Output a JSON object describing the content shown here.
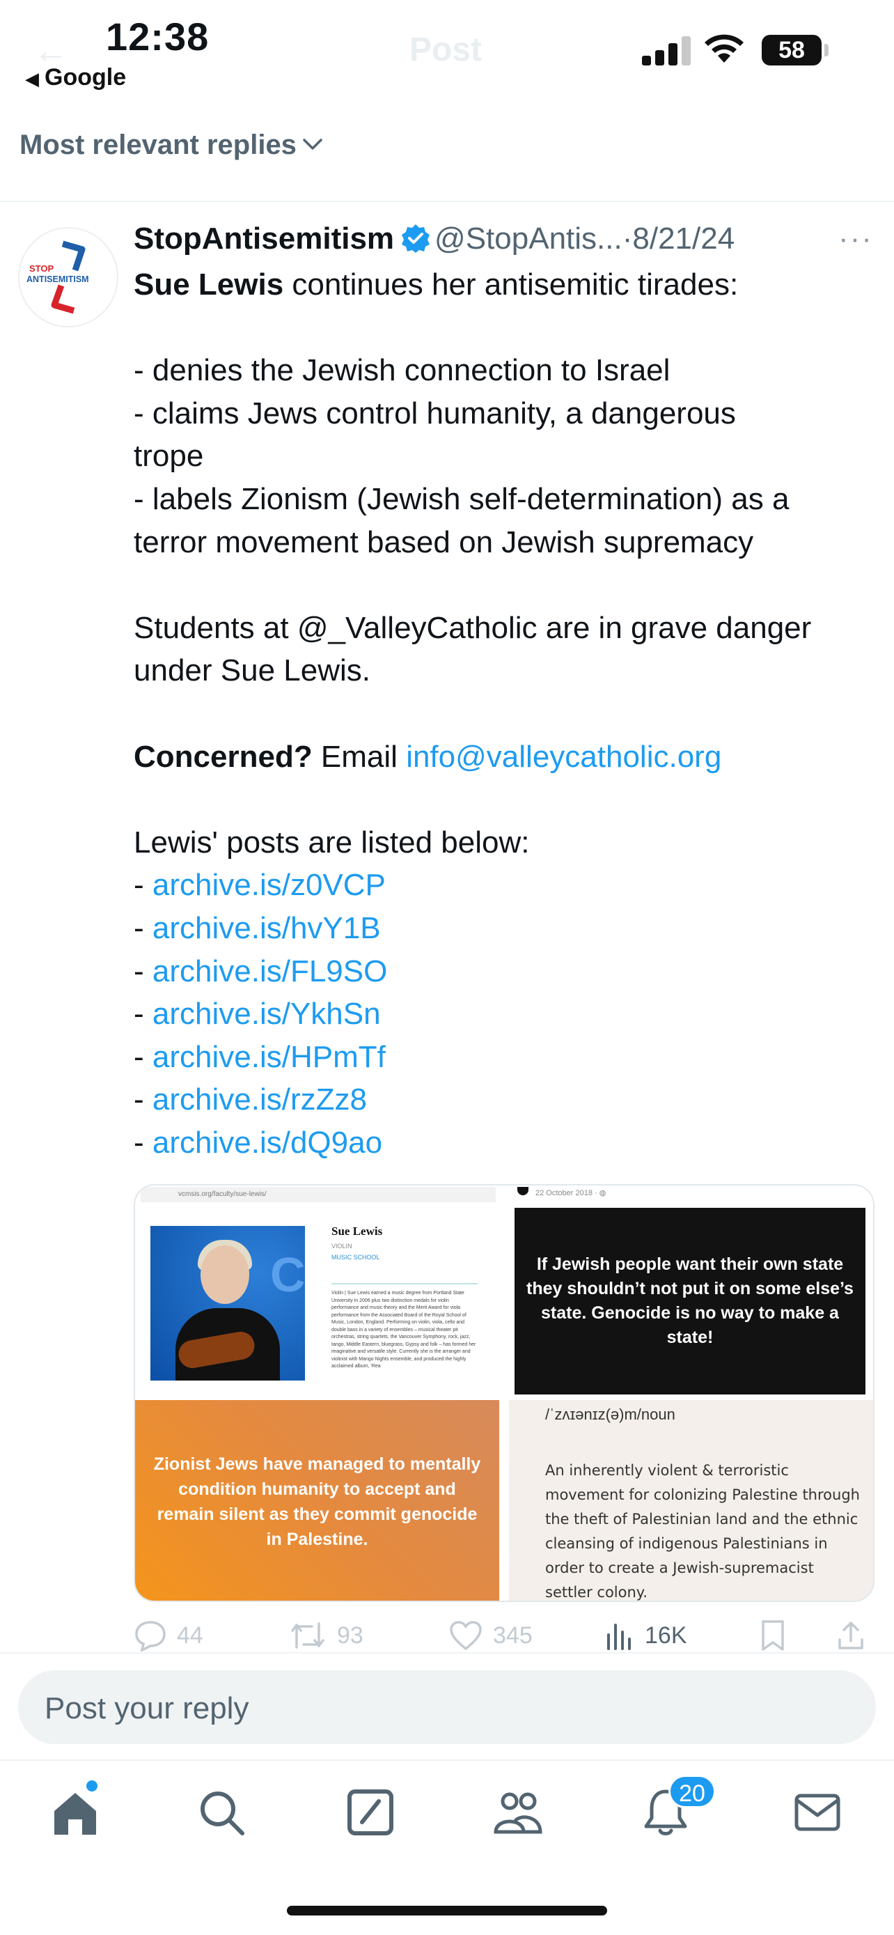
{
  "status_bar": {
    "time": "12:38",
    "back_app": "Google",
    "battery": "58",
    "faded_title": "Post"
  },
  "sort": {
    "label": "Most relevant replies"
  },
  "tweet": {
    "display_name": "StopAntisemitism",
    "handle": "@StopAntis...",
    "separator": "·",
    "date": "8/21/24",
    "more": "···",
    "avatar_text_top": "STOP",
    "avatar_text_bottom": "ANTISEMITISM",
    "body": {
      "intro_bold": "Sue Lewis",
      "intro_rest": " continues her antisemitic tirades:",
      "bullet1": "- denies the Jewish connection to Israel",
      "bullet2a": "- claims Jews control humanity, a dangerous",
      "bullet2b": "trope",
      "bullet3a": "- labels Zionism (Jewish self-determination) as a",
      "bullet3b": "terror movement based on Jewish supremacy",
      "students_a": "Students at @_ValleyCatholic are in grave danger",
      "students_b": "under Sue Lewis.",
      "concerned_bold": "Concerned?",
      "concerned_rest": " Email ",
      "email": "info@valleycatholic.org",
      "posts_intro": "Lewis' posts are listed below:",
      "link_prefix": "- ",
      "links": [
        "archive.is/z0VCP",
        "archive.is/hvY1B",
        "archive.is/FL9SO",
        "archive.is/YkhSn",
        "archive.is/HPmTf",
        "archive.is/rzZz8",
        "archive.is/dQ9ao"
      ]
    },
    "media": {
      "profile": {
        "url": "vcmsis.org/faculty/sue-lewis/",
        "name": "Sue Lewis",
        "instrument": "VIOLIN",
        "school": "MUSIC SCHOOL",
        "bio": "Violin | Sue Lewis earned a music degree from Portland State University in 2006 plus two distinction medals for violin performance and music theory and the Merit Award for viola performance from the Associated Board of the Royal School of Music, London, England. Performing on violin, viola, cello and double bass in a variety of ensembles – musical theater pit orchestras, string quartets, the Vancouver Symphony, rock, jazz, tango, Middle Eastern, bluegrass, Gypsy and folk – has formed her imaginative and versatile style. Currently she is the arranger and violinist with Mango Nights ensemble, and produced the highly acclaimed album, 'Rea"
      },
      "post_date": "22 October 2018 · ◍",
      "black_post": "If Jewish people want their own state they shouldn’t not put it on some else’s state. Genocide is no way to make a state!",
      "orange_post": "Zionist Jews have managed to mentally condition humanity to accept and remain silent as they commit genocide in Palestine.",
      "definition_phonetic": "/ˈzʌɪənɪz(ə)m/noun",
      "definition_text": "An inherently violent & terroristic movement for colonizing Palestine through the theft of Palestinian land and the ethnic cleansing of indigenous Palestinians in order to create a Jewish-supremacist settler colony."
    },
    "stats": {
      "replies": "44",
      "reposts": "93",
      "likes": "345",
      "views": "16K"
    }
  },
  "reply": {
    "placeholder": "Post your reply"
  },
  "tabbar": {
    "notifications_badge": "20"
  },
  "colors": {
    "link": "#1d9bf0",
    "text": "#0f1419",
    "secondary": "#536471"
  }
}
